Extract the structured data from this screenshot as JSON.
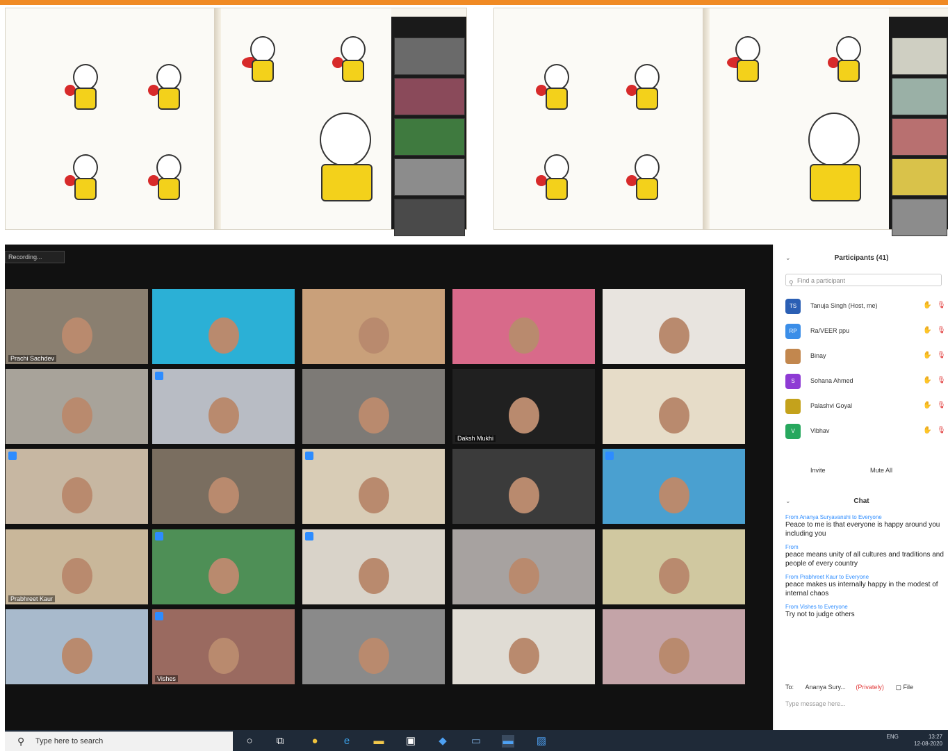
{
  "recording_label": "Recording...",
  "video_tiles": [
    {
      "name": "Prachi Sachdev",
      "mic": false
    },
    {
      "name": "",
      "mic": false
    },
    {
      "name": "",
      "mic": false
    },
    {
      "name": "",
      "mic": false
    },
    {
      "name": "",
      "mic": false
    },
    {
      "name": "",
      "mic": false
    },
    {
      "name": "",
      "mic": true
    },
    {
      "name": "",
      "mic": false
    },
    {
      "name": "Daksh Mukhi",
      "mic": false
    },
    {
      "name": "",
      "mic": false
    },
    {
      "name": "",
      "mic": true
    },
    {
      "name": "",
      "mic": false
    },
    {
      "name": "",
      "mic": true
    },
    {
      "name": "",
      "mic": false
    },
    {
      "name": "",
      "mic": true
    },
    {
      "name": "Prabhreet Kaur",
      "mic": false
    },
    {
      "name": "",
      "mic": true
    },
    {
      "name": "",
      "mic": true
    },
    {
      "name": "",
      "mic": false
    },
    {
      "name": "",
      "mic": false
    },
    {
      "name": "",
      "mic": false
    },
    {
      "name": "Vishes",
      "mic": true
    },
    {
      "name": "",
      "mic": false
    },
    {
      "name": "",
      "mic": false
    },
    {
      "name": "",
      "mic": false
    }
  ],
  "participants_panel": {
    "title": "Participants (41)",
    "search_placeholder": "Find a participant",
    "participants": [
      {
        "initials": "TS",
        "name": "Tanuja Singh (Host, me)",
        "color": "#2b5fb4"
      },
      {
        "initials": "RP",
        "name": "Ra/VEER ppu",
        "color": "#3b8ee8"
      },
      {
        "initials": "",
        "name": "Binay",
        "color": "#c2874e"
      },
      {
        "initials": "S",
        "name": "Sohana Ahmed",
        "color": "#8e3bd4"
      },
      {
        "initials": "",
        "name": "Palashvi Goyal",
        "color": "#c4a21c"
      },
      {
        "initials": "V",
        "name": "Vibhav",
        "color": "#27a85e"
      }
    ],
    "invite_label": "Invite",
    "mute_all_label": "Mute All"
  },
  "chat_panel": {
    "title": "Chat",
    "messages": [
      {
        "from": "From Ananya Suryavanshi to Everyone",
        "text": "Peace to me is that everyone is happy around you including you"
      },
      {
        "from": "From",
        "text": "peace means unity of all cultures and traditions and people of every country"
      },
      {
        "from": "From Prabhreet Kaur to Everyone",
        "text": "peace makes us internally happy in the modest of internal chaos"
      },
      {
        "from": "From Vishes to Everyone",
        "text": "Try not to judge others"
      }
    ],
    "to_label": "To:",
    "to_value": "Ananya Sury...",
    "private_label": "(Privately)",
    "file_label": "File",
    "type_placeholder": "Type message here..."
  },
  "taskbar": {
    "search_text": "Type here to search",
    "tray_lang": "ENG",
    "tray_time": "13:27",
    "tray_date": "12-08-2020"
  },
  "accent": "#f08a24"
}
